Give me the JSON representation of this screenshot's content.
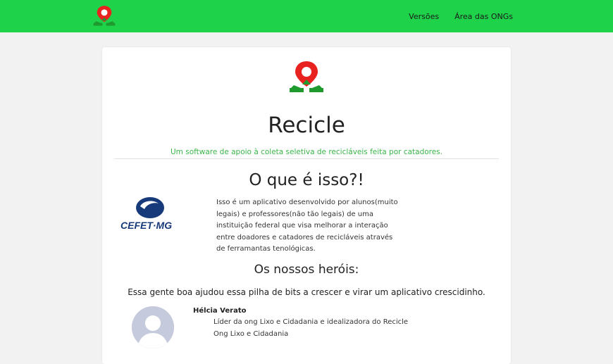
{
  "navbar": {
    "logo_icon": "recicle-logo-icon",
    "links": [
      {
        "label": "Versões"
      },
      {
        "label": "Área das ONGs"
      }
    ],
    "background": "#1ed34a"
  },
  "main": {
    "logo_icon": "recicle-logo-icon",
    "title": "Recicle",
    "subtitle": "Um software de apoio à coleta seletiva de recicláveis feita por catadores.",
    "about": {
      "heading": "O que é isso?!",
      "partner_logo": "cefet-mg-logo",
      "partner_logo_text": "CEFET-MG",
      "text": "Isso é um aplicativo desenvolvido por alunos(muito legais) e professores(não tão legais) de uma instituição federal que visa melhorar a interação entre doadores e catadores de recicláveis através de ferramantas tenológicas."
    },
    "heroes": {
      "heading": "Os nossos heróis:",
      "intro": "Essa gente boa ajudou essa pilha de bits a crescer e virar um aplicativo crescidinho.",
      "people": [
        {
          "avatar_icon": "default-avatar-icon",
          "name": "Hélcia Verato",
          "role": "Líder da ong Lixo e Cidadania e idealizadora do Recicle",
          "org": "Ong Lixo e Cidadania"
        }
      ]
    },
    "accent_color": "#3bb54a"
  }
}
